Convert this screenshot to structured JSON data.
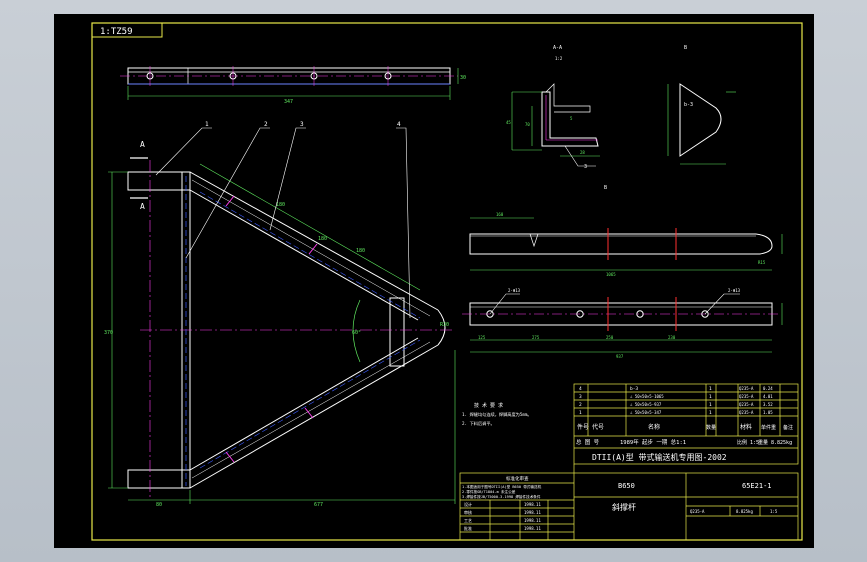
{
  "drawing": {
    "sheet_code": "1:TZ59",
    "title": "DTII(A)型 带式输送机专用图-2002",
    "part_name": "斜撑杆",
    "width_code": "B650",
    "drawing_no": "65E21-1",
    "scale": "1:5",
    "material": "Q235-A",
    "weight": "8.825kg"
  },
  "callouts": [
    "1",
    "2",
    "3",
    "4"
  ],
  "section_labels": {
    "a_top": "A",
    "a_bottom": "A",
    "aa": "A-A",
    "detail_b": "B",
    "detail_c": "C",
    "detail_b_inner": "b-3",
    "small_ratio": "1:2"
  },
  "dimensions": {
    "top_bar_length": "347",
    "top_bar_height": "30",
    "left_height": "370",
    "bottom_left": "80",
    "bottom_total": "677",
    "diag_1": "180",
    "diag_2": "180",
    "diag_3": "180",
    "bar_b_length": "1065",
    "bar_b_right": "R15",
    "bar_b_left": "160",
    "bar_c_total": "937",
    "bar_c_spacing_1": "125",
    "bar_c_spacing_2": "275",
    "bar_c_spacing_3": "250",
    "bar_c_spacing_4": "230",
    "bar_c_hole": "2-Φ13",
    "bar_c_hole_2": "2-Φ13",
    "angle": "60°",
    "radius": "R30",
    "aa_dim_1": "45",
    "aa_dim_2": "70",
    "aa_dim_3": "5",
    "aa_dim_4": "28"
  },
  "notes": {
    "heading": "技 术 要 求",
    "line1": "1. 焊缝均匀连续，焊脚高度为5mm。",
    "line2": "2. 下料后调平。"
  },
  "parts_table": {
    "rows": [
      {
        "no": "4",
        "code": "",
        "name": "b-3",
        "qty": "1",
        "material": "Q235-A",
        "mass": "0.24",
        "note": ""
      },
      {
        "no": "3",
        "code": "",
        "name": "∠ 50×50×5-1065",
        "qty": "1",
        "material": "Q235-A",
        "mass": "4.01",
        "note": ""
      },
      {
        "no": "2",
        "code": "",
        "name": "∠ 50×50×5-937",
        "qty": "1",
        "material": "Q235-A",
        "mass": "3.52",
        "note": ""
      },
      {
        "no": "1",
        "code": "",
        "name": "∠ 50×50×5-347",
        "qty": "1",
        "material": "Q235-A",
        "mass": "1.05",
        "note": ""
      }
    ],
    "header": {
      "no": "件号",
      "code": "代号",
      "name": "名称",
      "qty": "数量",
      "material": "材料",
      "mass": "单件重",
      "note": "备注"
    },
    "footer_left": "总 图 号",
    "footer_mid": "1989年 起步 一期 总1:1",
    "footer_right": "比例 1:5",
    "footer_weight": "重量 8.825kg"
  },
  "revision_table": {
    "heading": "标准化审查",
    "lines": [
      "1.本图适用于图号DTII(A)型 B650 带式输送机",
      "2.零件按GB/T1804-m 未注公差",
      "3.焊接件按JB/T5000.3-1998 焊接件技术条件"
    ],
    "sign_rows": [
      {
        "role": "设计",
        "name": "",
        "date": "1998.11"
      },
      {
        "role": "审核",
        "name": "",
        "date": "1998.11"
      },
      {
        "role": "工艺",
        "name": "",
        "date": "1998.11"
      },
      {
        "role": "批准",
        "name": "",
        "date": "1998.11"
      }
    ]
  }
}
